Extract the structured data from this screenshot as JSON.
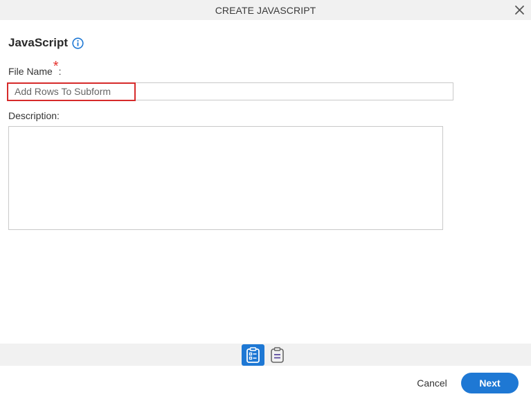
{
  "dialog": {
    "title": "CREATE JAVASCRIPT",
    "close_icon": "close-icon"
  },
  "section": {
    "title": "JavaScript",
    "info_icon": "info-icon"
  },
  "form": {
    "file_name_label": "File Name",
    "required_mark": "*",
    "label_suffix": ":",
    "file_name_value": "Add Rows To Subform",
    "description_label": "Description",
    "description_value": ""
  },
  "steps": [
    {
      "icon": "clipboard-form-icon",
      "active": true
    },
    {
      "icon": "clipboard-list-icon",
      "active": false
    }
  ],
  "footer": {
    "cancel_label": "Cancel",
    "next_label": "Next"
  },
  "colors": {
    "accent": "#1e78d4",
    "required": "#e5322d",
    "highlight": "#d62a2a",
    "inactive_icon": "#5b4a9e"
  }
}
